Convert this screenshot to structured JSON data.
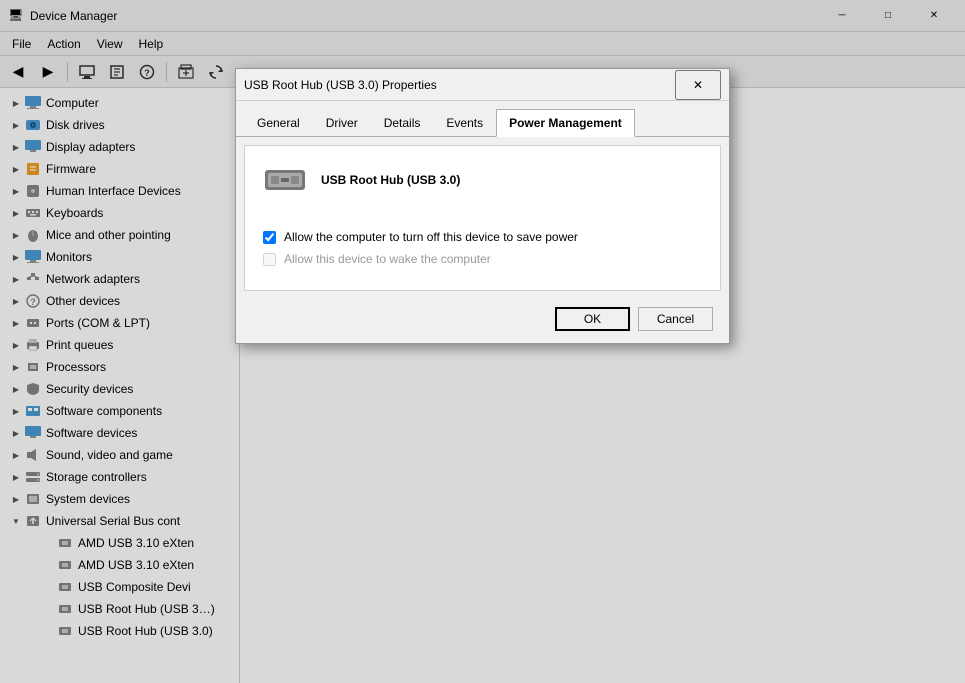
{
  "window": {
    "title": "Device Manager",
    "icon": "🖥"
  },
  "titlebar_controls": {
    "minimize": "─",
    "maximize": "□",
    "close": "✕"
  },
  "menu": {
    "items": [
      "File",
      "Action",
      "View",
      "Help"
    ]
  },
  "toolbar": {
    "buttons": [
      "←",
      "→",
      "🖥",
      "📋",
      "❓",
      "☰",
      "🖨"
    ]
  },
  "tree": {
    "items": [
      {
        "label": "Computer",
        "level": 0,
        "arrow": "collapsed",
        "icon": "🖥"
      },
      {
        "label": "Disk drives",
        "level": 0,
        "arrow": "collapsed",
        "icon": "💾"
      },
      {
        "label": "Display adapters",
        "level": 0,
        "arrow": "collapsed",
        "icon": "🖥"
      },
      {
        "label": "Firmware",
        "level": 0,
        "arrow": "collapsed",
        "icon": "📋"
      },
      {
        "label": "Human Interface Devices",
        "level": 0,
        "arrow": "collapsed",
        "icon": "🖱"
      },
      {
        "label": "Keyboards",
        "level": 0,
        "arrow": "collapsed",
        "icon": "⌨"
      },
      {
        "label": "Mice and other pointing",
        "level": 0,
        "arrow": "collapsed",
        "icon": "🖱"
      },
      {
        "label": "Monitors",
        "level": 0,
        "arrow": "collapsed",
        "icon": "🖥"
      },
      {
        "label": "Network adapters",
        "level": 0,
        "arrow": "collapsed",
        "icon": "🌐"
      },
      {
        "label": "Other devices",
        "level": 0,
        "arrow": "collapsed",
        "icon": "❓"
      },
      {
        "label": "Ports (COM & LPT)",
        "level": 0,
        "arrow": "collapsed",
        "icon": "🔌"
      },
      {
        "label": "Print queues",
        "level": 0,
        "arrow": "collapsed",
        "icon": "🖨"
      },
      {
        "label": "Processors",
        "level": 0,
        "arrow": "collapsed",
        "icon": "⚙"
      },
      {
        "label": "Security devices",
        "level": 0,
        "arrow": "collapsed",
        "icon": "🔒"
      },
      {
        "label": "Software components",
        "level": 0,
        "arrow": "collapsed",
        "icon": "📦"
      },
      {
        "label": "Software devices",
        "level": 0,
        "arrow": "collapsed",
        "icon": "💻"
      },
      {
        "label": "Sound, video and game",
        "level": 0,
        "arrow": "collapsed",
        "icon": "🔊"
      },
      {
        "label": "Storage controllers",
        "level": 0,
        "arrow": "collapsed",
        "icon": "💾"
      },
      {
        "label": "System devices",
        "level": 0,
        "arrow": "collapsed",
        "icon": "⚙"
      },
      {
        "label": "Universal Serial Bus cont",
        "level": 0,
        "arrow": "expanded",
        "icon": "🔌"
      },
      {
        "label": "AMD USB 3.10 eXten",
        "level": 1,
        "arrow": "none",
        "icon": "🔌"
      },
      {
        "label": "AMD USB 3.10 eXten",
        "level": 1,
        "arrow": "none",
        "icon": "🔌"
      },
      {
        "label": "USB Composite Devi",
        "level": 1,
        "arrow": "none",
        "icon": "🔌"
      },
      {
        "label": "USB Root Hub (USB 3…)",
        "level": 1,
        "arrow": "none",
        "icon": "🔌"
      },
      {
        "label": "USB Root Hub (USB 3.0)",
        "level": 1,
        "arrow": "none",
        "icon": "🔌"
      }
    ]
  },
  "dialog": {
    "title": "USB Root Hub (USB 3.0) Properties",
    "device_name": "USB Root Hub (USB 3.0)",
    "tabs": [
      "General",
      "Driver",
      "Details",
      "Events",
      "Power Management"
    ],
    "active_tab": "Power Management",
    "checkbox1_label": "Allow the computer to turn off this device to save power",
    "checkbox1_checked": true,
    "checkbox2_label": "Allow this device to wake the computer",
    "checkbox2_checked": false,
    "checkbox2_disabled": true,
    "ok_label": "OK",
    "cancel_label": "Cancel"
  }
}
